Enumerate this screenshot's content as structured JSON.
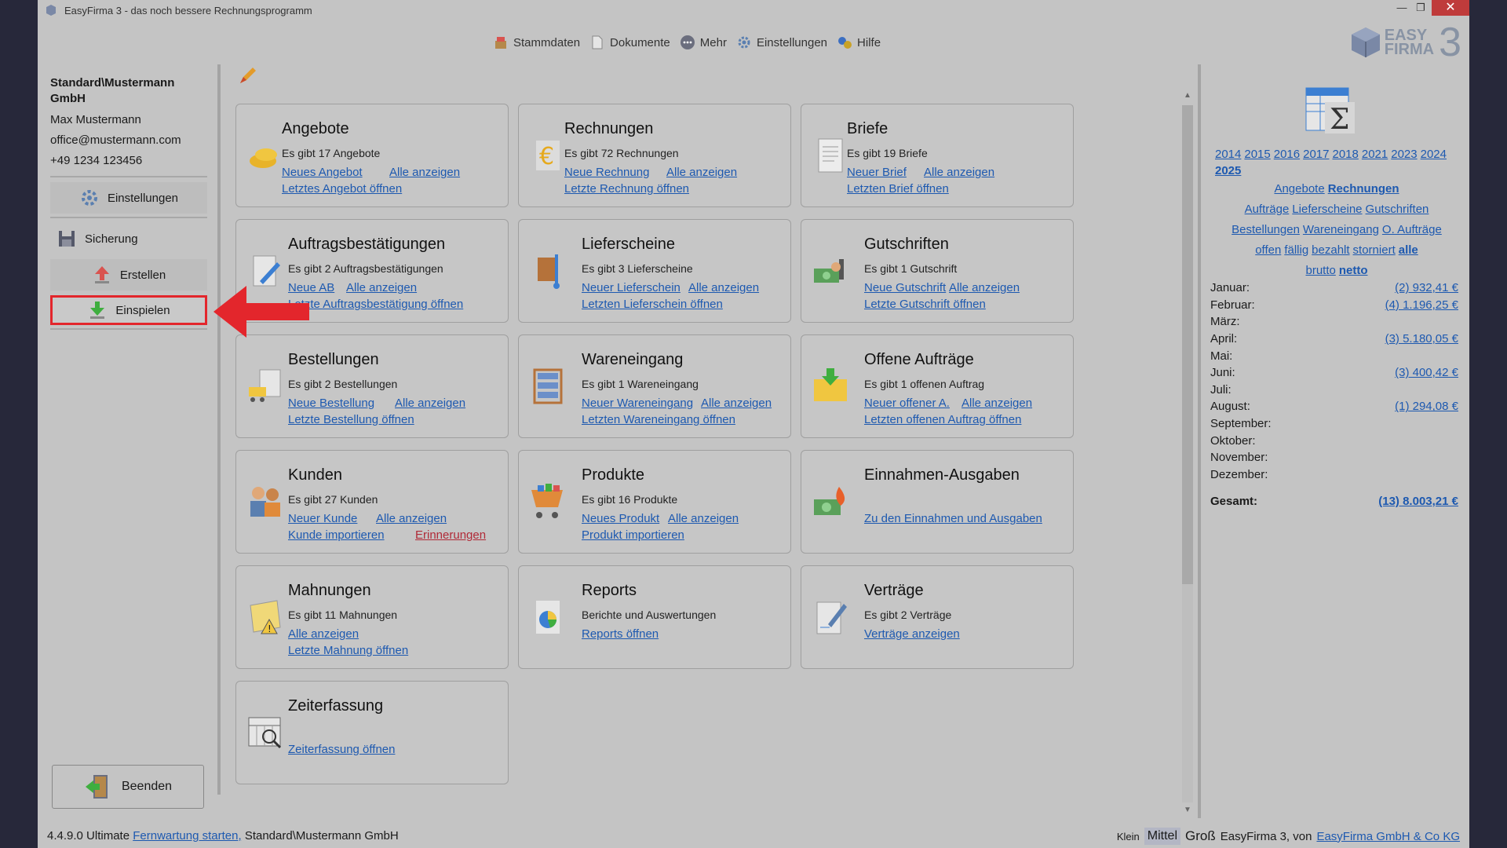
{
  "window": {
    "title": "EasyFirma 3 - das noch bessere Rechnungsprogramm",
    "controls": {
      "minimize": "—",
      "restore": "❐",
      "close": "✕"
    }
  },
  "menu": [
    {
      "label": "Stammdaten",
      "icon": "stammdaten-icon"
    },
    {
      "label": "Dokumente",
      "icon": "document-icon"
    },
    {
      "label": "Mehr",
      "icon": "more-icon"
    },
    {
      "label": "Einstellungen",
      "icon": "gear-icon"
    },
    {
      "label": "Hilfe",
      "icon": "help-icon"
    }
  ],
  "logo": {
    "line1": "EASY",
    "line2": "FIRMA",
    "number": "3"
  },
  "sidebar": {
    "company": "Standard\\Mustermann GmbH",
    "name": "Max Mustermann",
    "email": "office@mustermann.com",
    "phone": "+49 1234 123456",
    "buttons": {
      "einstellungen": "Einstellungen",
      "sicherung": "Sicherung",
      "erstellen": "Erstellen",
      "einspielen": "Einspielen"
    },
    "beenden": "Beenden"
  },
  "cards": {
    "angebote": {
      "title": "Angebote",
      "sub": "Es gibt 17 Angebote",
      "l1": "Neues Angebot",
      "l2": "Alle anzeigen",
      "l3": "Letztes Angebot öffnen"
    },
    "rechnungen": {
      "title": "Rechnungen",
      "sub": "Es gibt 72 Rechnungen",
      "l1": "Neue Rechnung",
      "l2": "Alle anzeigen",
      "l3": "Letzte Rechnung öffnen"
    },
    "briefe": {
      "title": "Briefe",
      "sub": "Es gibt 19 Briefe",
      "l1": "Neuer Brief",
      "l2": "Alle anzeigen",
      "l3": "Letzten Brief öffnen"
    },
    "ab": {
      "title": "Auftragsbestätigungen",
      "sub": "Es gibt 2 Auftragsbestätigungen",
      "l1": "Neue AB",
      "l2": "Alle anzeigen",
      "l3": "Letzte Auftragsbestätigung öffnen"
    },
    "lieferscheine": {
      "title": "Lieferscheine",
      "sub": "Es gibt 3 Lieferscheine",
      "l1": "Neuer Lieferschein",
      "l2": "Alle anzeigen",
      "l3": "Letzten Lieferschein öffnen"
    },
    "gutschriften": {
      "title": "Gutschriften",
      "sub": "Es gibt 1 Gutschrift",
      "l1": "Neue Gutschrift",
      "l2": "Alle anzeigen",
      "l3": "Letzte Gutschrift öffnen"
    },
    "bestellungen": {
      "title": "Bestellungen",
      "sub": "Es gibt 2 Bestellungen",
      "l1": "Neue Bestellung",
      "l2": "Alle anzeigen",
      "l3": "Letzte Bestellung öffnen"
    },
    "wareneingang": {
      "title": "Wareneingang",
      "sub": "Es gibt 1 Wareneingang",
      "l1": "Neuer Wareneingang",
      "l2": "Alle anzeigen",
      "l3": "Letzten Wareneingang öffnen"
    },
    "offene": {
      "title": "Offene Aufträge",
      "sub": "Es gibt 1 offenen Auftrag",
      "l1": "Neuer offener A.",
      "l2": "Alle anzeigen",
      "l3": "Letzten offenen Auftrag öffnen"
    },
    "kunden": {
      "title": "Kunden",
      "sub": "Es gibt 27 Kunden",
      "l1": "Neuer Kunde",
      "l2": "Alle anzeigen",
      "l3": "Kunde importieren",
      "l4": "Erinnerungen"
    },
    "produkte": {
      "title": "Produkte",
      "sub": "Es gibt 16 Produkte",
      "l1": "Neues Produkt",
      "l2": "Alle anzeigen",
      "l3": "Produkt importieren"
    },
    "ea": {
      "title": "Einnahmen-Ausgaben",
      "l1": "Zu den Einnahmen und Ausgaben"
    },
    "mahnungen": {
      "title": "Mahnungen",
      "sub": "Es gibt 11 Mahnungen",
      "l1": "Alle anzeigen",
      "l2": "Letzte Mahnung öffnen"
    },
    "reports": {
      "title": "Reports",
      "sub": "Berichte und Auswertungen",
      "l1": "Reports öffnen"
    },
    "vertraege": {
      "title": "Verträge",
      "sub": "Es gibt 2 Verträge",
      "l1": "Verträge anzeigen"
    },
    "zeit": {
      "title": "Zeiterfassung",
      "l1": "Zeiterfassung öffnen"
    }
  },
  "right": {
    "years": [
      "2014",
      "2015",
      "2016",
      "2017",
      "2018",
      "2021",
      "2023",
      "2024",
      "2025"
    ],
    "selected_year": "2025",
    "doc_links": {
      "angebote": "Angebote",
      "rechnungen": "Rechnungen",
      "auftraege": "Aufträge",
      "lieferscheine": "Lieferscheine",
      "gutschriften": "Gutschriften",
      "bestellungen": "Bestellungen",
      "wareneingang": "Wareneingang",
      "o_auftraege": "O. Aufträge",
      "offen": "offen",
      "faellig": "fällig",
      "bezahlt": "bezahlt",
      "storniert": "storniert",
      "alle": "alle",
      "brutto": "brutto",
      "netto": "netto"
    },
    "months": [
      {
        "m": "Januar:",
        "v": "(2)  932,41 €"
      },
      {
        "m": "Februar:",
        "v": "(4)  1.196,25 €"
      },
      {
        "m": "März:",
        "v": ""
      },
      {
        "m": "April:",
        "v": "(3)  5.180,05 €"
      },
      {
        "m": "Mai:",
        "v": ""
      },
      {
        "m": "Juni:",
        "v": "(3)  400,42 €"
      },
      {
        "m": "Juli:",
        "v": ""
      },
      {
        "m": "August:",
        "v": "(1)  294,08 €"
      },
      {
        "m": "September:",
        "v": ""
      },
      {
        "m": "Oktober:",
        "v": ""
      },
      {
        "m": "November:",
        "v": ""
      },
      {
        "m": "Dezember:",
        "v": ""
      }
    ],
    "total_label": "Gesamt:",
    "total_value": "(13) 8.003,21 €"
  },
  "status": {
    "version": "4.4.9.0 Ultimate",
    "remote": "Fernwartung starten,",
    "company": "Standard\\Mustermann GmbH",
    "size_small": "Klein",
    "size_medium": "Mittel",
    "size_large": "Groß",
    "credit": "EasyFirma 3, von",
    "company_link": "EasyFirma GmbH & Co KG"
  },
  "colors": {
    "link": "#1d59b0",
    "highlight": "#e3262c",
    "background": "#c4c4c4"
  }
}
